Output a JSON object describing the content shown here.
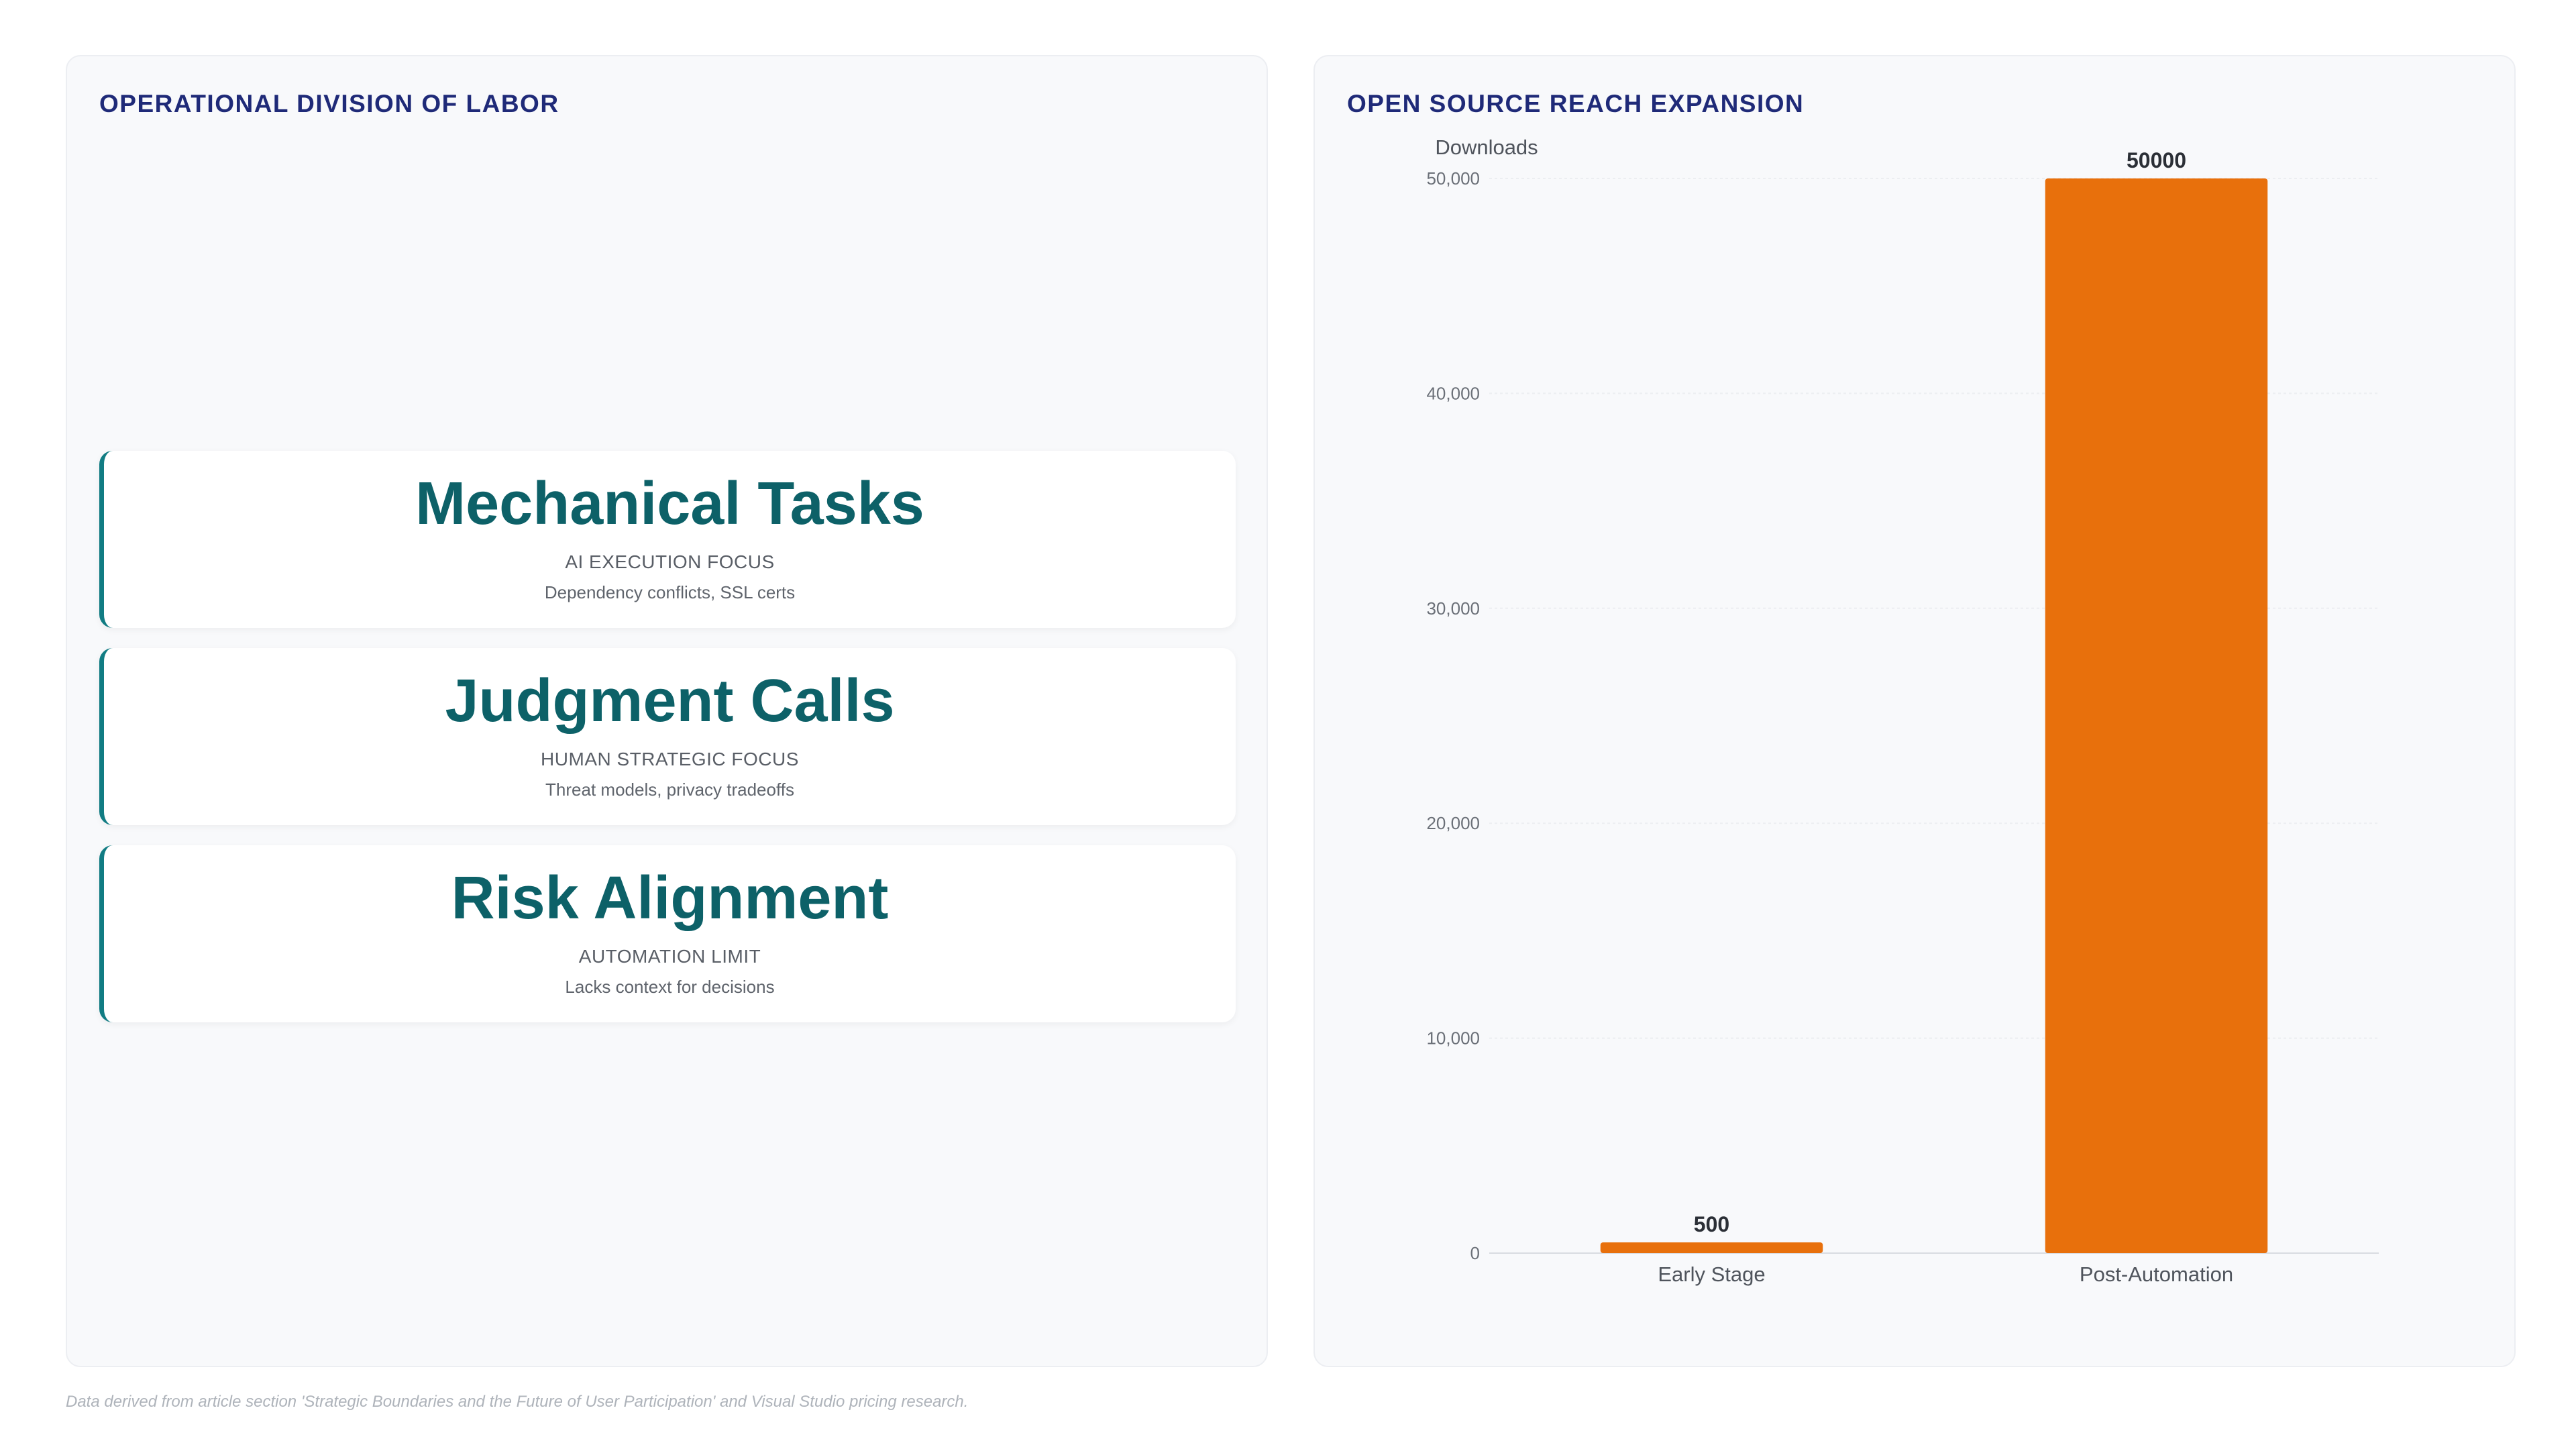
{
  "left_panel": {
    "title": "OPERATIONAL DIVISION OF LABOR",
    "cards": [
      {
        "title": "Mechanical Tasks",
        "subtitle": "AI EXECUTION FOCUS",
        "description": "Dependency conflicts, SSL certs"
      },
      {
        "title": "Judgment Calls",
        "subtitle": "HUMAN STRATEGIC FOCUS",
        "description": "Threat models, privacy tradeoffs"
      },
      {
        "title": "Risk Alignment",
        "subtitle": "AUTOMATION LIMIT",
        "description": "Lacks context for decisions"
      }
    ]
  },
  "right_panel": {
    "title": "OPEN SOURCE REACH EXPANSION"
  },
  "chart_data": {
    "type": "bar",
    "title": "OPEN SOURCE REACH EXPANSION",
    "ylabel": "Downloads",
    "xlabel": "",
    "categories": [
      "Early Stage",
      "Post-Automation"
    ],
    "values": [
      500,
      50000
    ],
    "data_labels": [
      "500",
      "50000"
    ],
    "ylim": [
      0,
      50000
    ],
    "yticks": [
      0,
      10000,
      20000,
      30000,
      40000,
      50000
    ],
    "ytick_labels": [
      "0",
      "10,000",
      "20,000",
      "30,000",
      "40,000",
      "50,000"
    ],
    "grid": true,
    "legend": "none",
    "bar_color": "#e8700c"
  },
  "footer": {
    "note": "Data derived from article section 'Strategic Boundaries and the Future of User Participation' and Visual Studio pricing research."
  }
}
